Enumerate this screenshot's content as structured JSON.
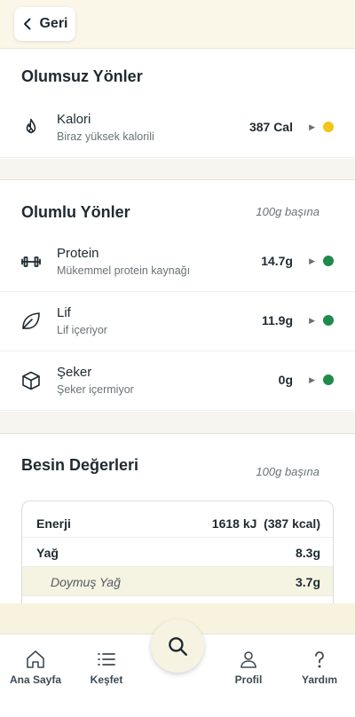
{
  "header": {
    "back_label": "Geri"
  },
  "negatives": {
    "title": "Olumsuz Yönler",
    "items": [
      {
        "title": "Kalori",
        "subtitle": "Biraz yüksek kalorili",
        "value": "387 Cal",
        "icon": "flame-icon",
        "status_color": "#f5c518"
      }
    ]
  },
  "positives": {
    "title": "Olumlu Yönler",
    "per": "100g başına",
    "items": [
      {
        "title": "Protein",
        "subtitle": "Mükemmel protein kaynağı",
        "value": "14.7g",
        "icon": "dumbbell-icon",
        "status_color": "#1f8a4c"
      },
      {
        "title": "Lif",
        "subtitle": "Lif içeriyor",
        "value": "11.9g",
        "icon": "leaf-icon",
        "status_color": "#1f8a4c"
      },
      {
        "title": "Şeker",
        "subtitle": "Şeker içermiyor",
        "value": "0g",
        "icon": "cube-icon",
        "status_color": "#1f8a4c"
      }
    ]
  },
  "nutrition": {
    "title": "Besin Değerleri",
    "per": "100g başına",
    "rows": [
      {
        "label": "Enerji",
        "value": "1618 kJ  (387 kcal)"
      },
      {
        "label": "Yağ",
        "value": "8.3g"
      },
      {
        "label": "Doymuş Yağ",
        "value": "3.7g"
      }
    ]
  },
  "nav": {
    "home": "Ana Sayfa",
    "explore": "Keşfet",
    "profile": "Profil",
    "help": "Yardım"
  }
}
